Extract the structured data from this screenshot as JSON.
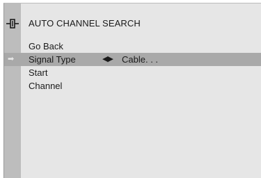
{
  "menu": {
    "title": "AUTO CHANNEL SEARCH",
    "items": [
      {
        "label": "Go Back"
      },
      {
        "label": "Signal Type",
        "value": "Cable. . .",
        "selected": true
      },
      {
        "label": "Start"
      },
      {
        "label": "Channel"
      }
    ]
  },
  "icons": {
    "header": "antenna-connector-icon",
    "row_pointer": "arrow-right-icon",
    "adjust": "left-right-arrows-icon"
  },
  "colors": {
    "background": "#e6e6e6",
    "rail": "#bdbdbd",
    "highlight": "#a9a9a9",
    "text": "#1a1a1a"
  }
}
